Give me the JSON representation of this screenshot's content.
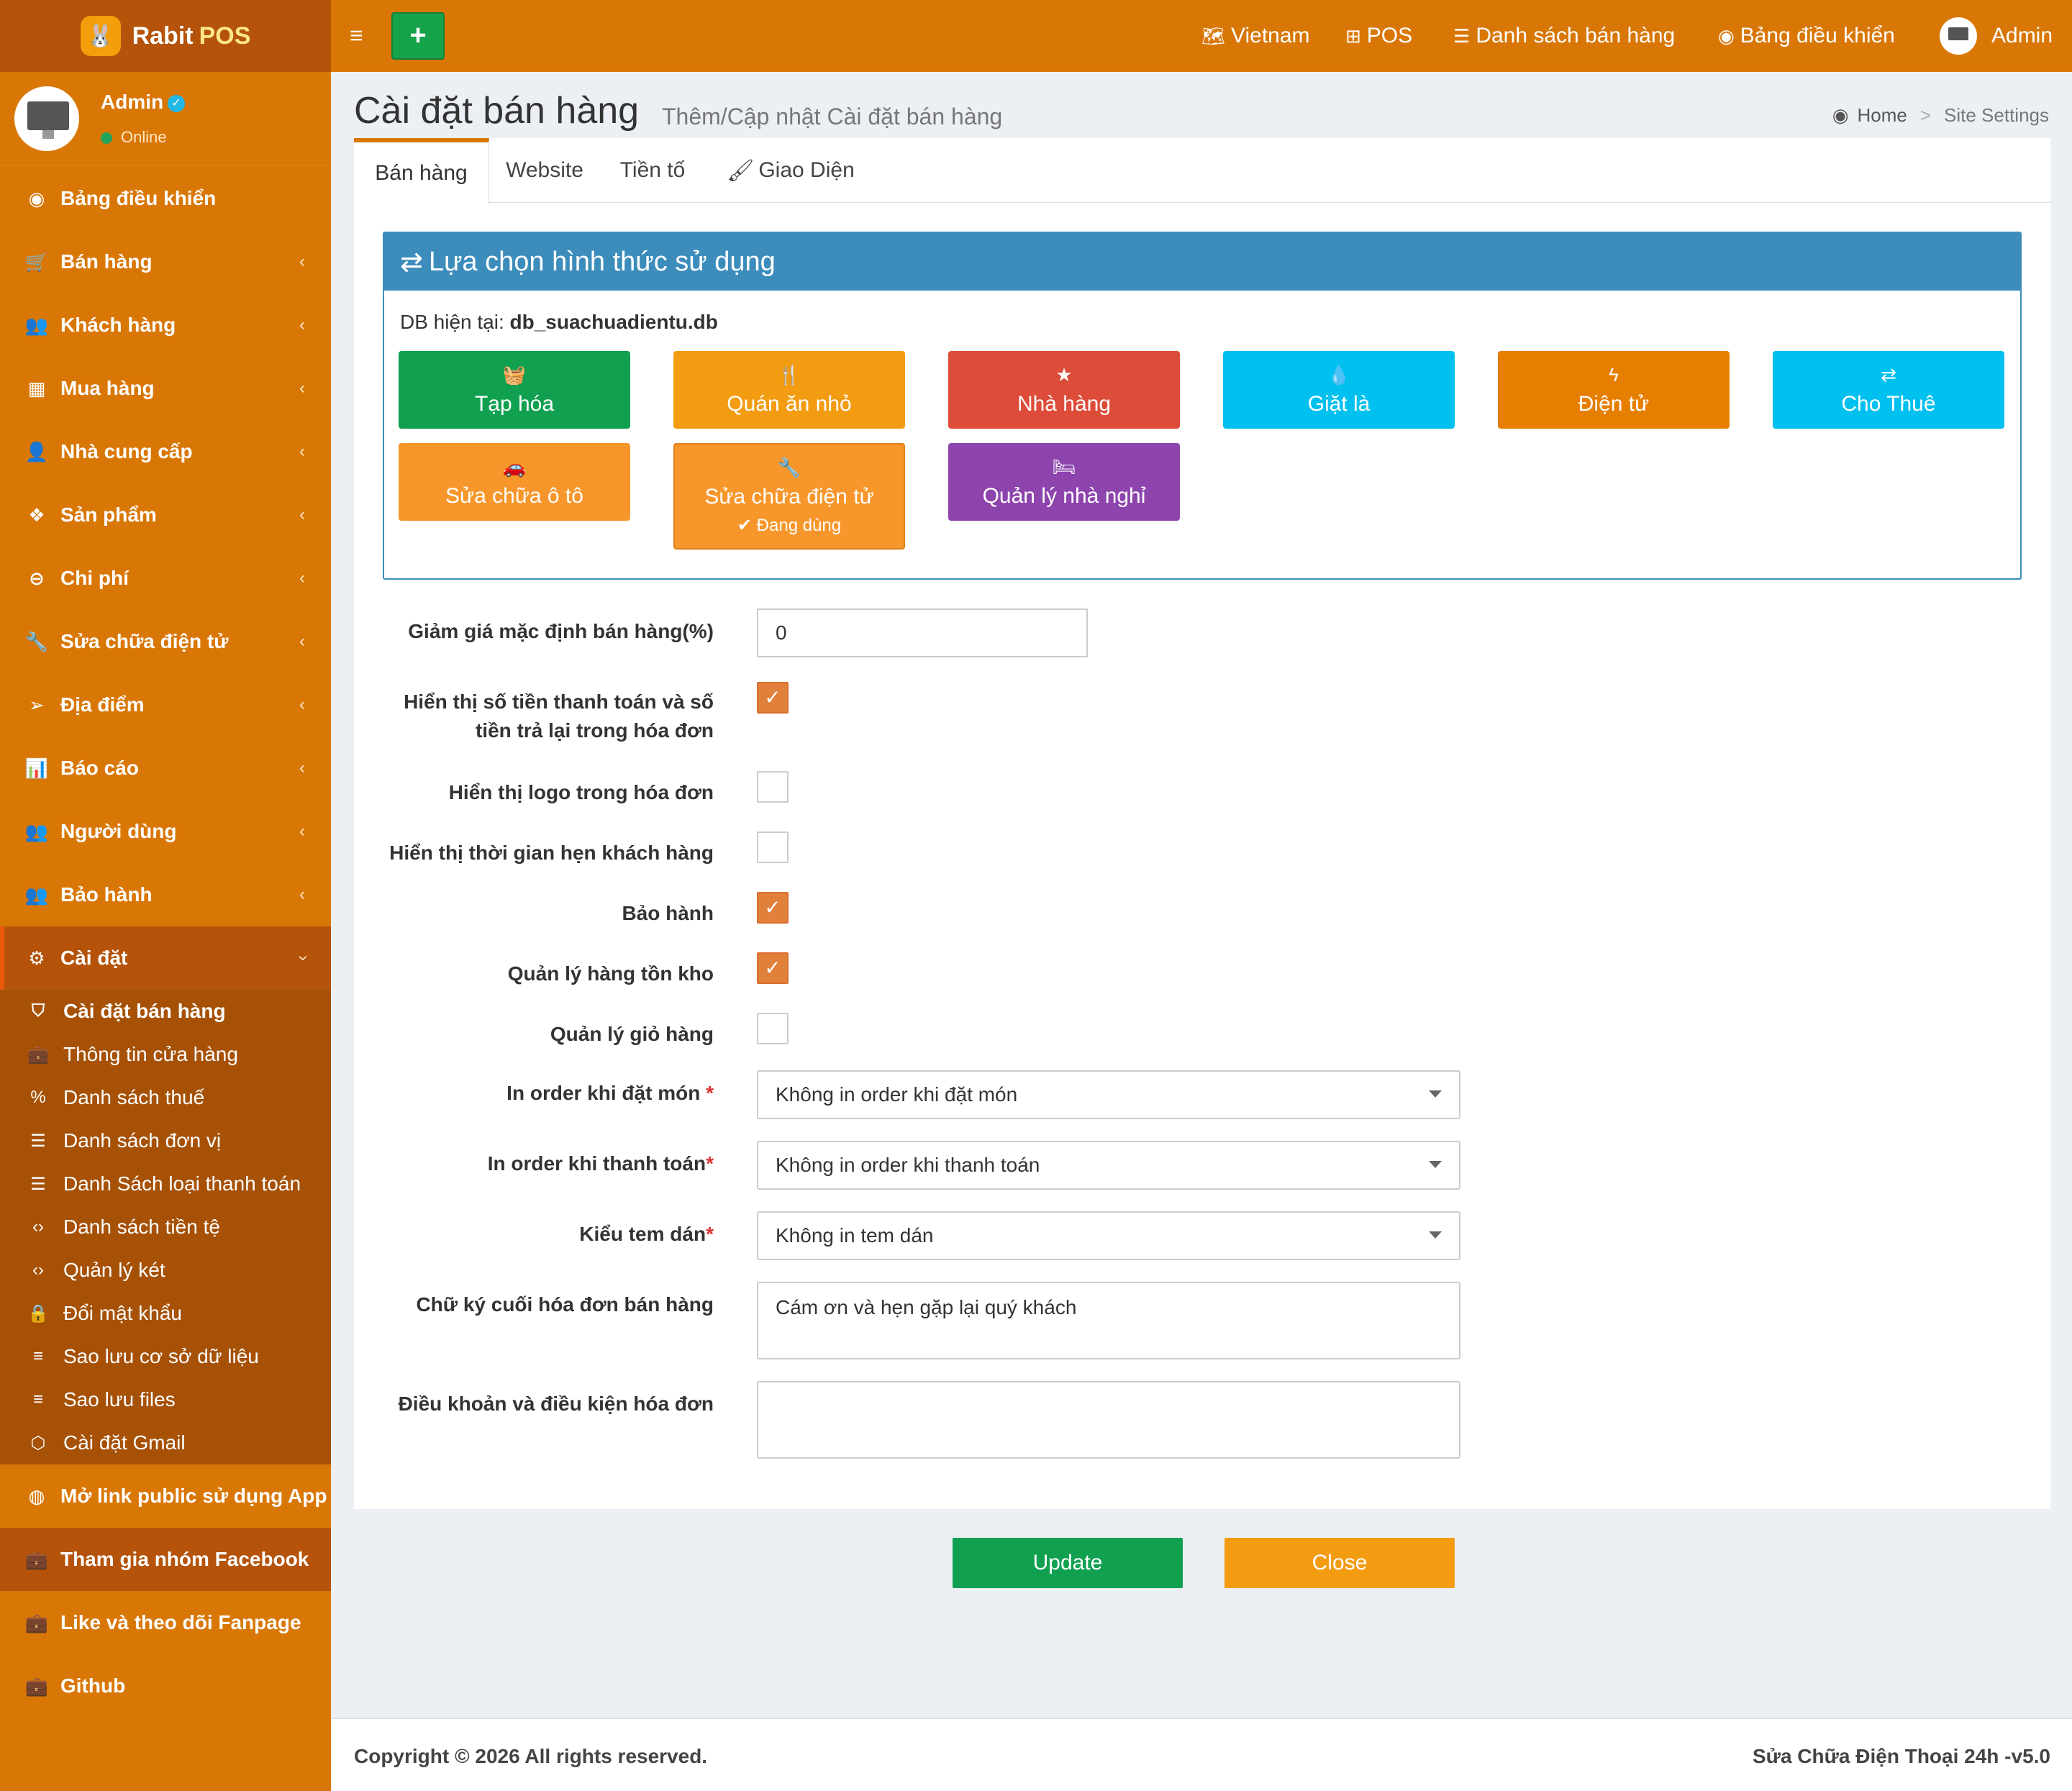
{
  "app": {
    "brand": "Rabit",
    "brand_suffix": "POS"
  },
  "user": {
    "name": "Admin",
    "status": "Online"
  },
  "sidebar": {
    "items": [
      {
        "label": "Bảng điều khiển",
        "icon": "dashboard-icon"
      },
      {
        "label": "Bán hàng",
        "icon": "cart-icon"
      },
      {
        "label": "Khách hàng",
        "icon": "users-icon"
      },
      {
        "label": "Mua hàng",
        "icon": "grid-icon"
      },
      {
        "label": "Nhà cung cấp",
        "icon": "user-plus-icon"
      },
      {
        "label": "Sản phẩm",
        "icon": "cubes-icon"
      },
      {
        "label": "Chi phí",
        "icon": "minus-circle-icon"
      },
      {
        "label": "Sửa chữa điện tử",
        "icon": "wrench-icon"
      },
      {
        "label": "Địa điểm",
        "icon": "paper-plane-icon"
      },
      {
        "label": "Báo cáo",
        "icon": "bar-chart-icon"
      },
      {
        "label": "Người dùng",
        "icon": "users-icon"
      },
      {
        "label": "Bảo hành",
        "icon": "users-icon"
      },
      {
        "label": "Cài đặt",
        "icon": "gears-icon"
      }
    ],
    "submenu": [
      {
        "label": "Cài đặt bán hàng",
        "icon": "shield-icon"
      },
      {
        "label": "Thông tin cửa hàng",
        "icon": "briefcase-icon"
      },
      {
        "label": "Danh sách thuế",
        "icon": "percent-icon"
      },
      {
        "label": "Danh sách đơn vị",
        "icon": "list-icon"
      },
      {
        "label": "Danh Sách loại thanh toán",
        "icon": "list-icon"
      },
      {
        "label": "Danh sách tiền tệ",
        "icon": "code-icon"
      },
      {
        "label": "Quản lý két",
        "icon": "code-icon"
      },
      {
        "label": "Đổi mật khẩu",
        "icon": "lock-icon"
      },
      {
        "label": "Sao lưu cơ sở dữ liệu",
        "icon": "database-icon"
      },
      {
        "label": "Sao lưu files",
        "icon": "database-icon"
      },
      {
        "label": "Cài đặt Gmail",
        "icon": "cube-icon"
      }
    ],
    "extra": [
      {
        "label": "Mở link public sử dụng App",
        "icon": "globe-icon"
      },
      {
        "label": "Tham gia nhóm Facebook",
        "icon": "briefcase-icon"
      },
      {
        "label": "Like và theo dõi Fanpage",
        "icon": "briefcase-icon"
      },
      {
        "label": "Github",
        "icon": "briefcase-icon"
      }
    ]
  },
  "topbar": {
    "language": "Vietnam",
    "pos": "POS",
    "sales_list": "Danh sách bán hàng",
    "dashboard": "Bảng điều khiển",
    "admin": "Admin"
  },
  "header": {
    "title": "Cài đặt bán hàng",
    "subtitle": "Thêm/Cập nhật Cài đặt bán hàng",
    "breadcrumb": [
      "Home",
      "Site Settings"
    ]
  },
  "tabs": [
    "Bán hàng",
    "Website",
    "Tiền tố",
    "Giao Diện"
  ],
  "choice": {
    "title": "Lựa chọn hình thức sử dụng",
    "db_label": "DB hiện tại:",
    "db_name": "db_suachuadientu.db",
    "modes": [
      {
        "label": "Tạp hóa",
        "icon": "basket-icon",
        "color": "#10a050"
      },
      {
        "label": "Quán ăn nhỏ",
        "icon": "cutlery-icon",
        "color": "#f39c12"
      },
      {
        "label": "Nhà hàng",
        "icon": "star-icon",
        "color": "#dd4b39"
      },
      {
        "label": "Giặt là",
        "icon": "drop-icon",
        "color": "#00c0ef"
      },
      {
        "label": "Điện tử",
        "icon": "bolt-icon",
        "color": "#e67e00"
      },
      {
        "label": "Cho Thuê",
        "icon": "exchange-icon",
        "color": "#00c0ef"
      },
      {
        "label": "Sửa chữa ô tô",
        "icon": "car-icon",
        "color": "#f7962a"
      },
      {
        "label": "Sửa chữa điện tử",
        "icon": "wrench-icon",
        "color": "#f7962a",
        "badge": "Đang dùng"
      },
      {
        "label": "Quản lý nhà nghỉ",
        "icon": "bed-icon",
        "color": "#8e44ad"
      }
    ]
  },
  "form": {
    "discount_label": "Giảm giá mặc định bán hàng(%)",
    "discount_value": "0",
    "show_paid_label_1": "Hiển thị số tiền thanh toán và số",
    "show_paid_label_2": "tiền trả lại trong hóa đơn",
    "show_paid": true,
    "show_logo_label": "Hiển thị logo trong hóa đơn",
    "show_logo": false,
    "show_appointment_label": "Hiển thị thời gian hẹn khách hàng",
    "show_appointment": false,
    "warranty_label": "Bảo hành",
    "warranty": true,
    "inventory_label": "Quản lý hàng tồn kho",
    "inventory": true,
    "cart_label": "Quản lý giỏ hàng",
    "cart": false,
    "print_order_label": "In order khi đặt món",
    "print_order_value": "Không in order khi đặt món",
    "print_pay_label": "In order khi thanh toán",
    "print_pay_value": "Không in order khi thanh toán",
    "sticker_label": "Kiểu tem dán",
    "sticker_value": "Không in tem dán",
    "signature_label": "Chữ ký cuối hóa đơn bán hàng",
    "signature_value": "Cám ơn và hẹn gặp lại quý khách",
    "terms_label": "Điều khoản và điều kiện hóa đơn",
    "terms_value": ""
  },
  "actions": {
    "update": "Update",
    "close": "Close",
    "update_color": "#10a050",
    "close_color": "#f39c12"
  },
  "footer": {
    "copyright": "Copyright © 2026 All rights reserved.",
    "version": "Sửa Chữa Điện Thoại 24h -v5.0"
  },
  "colors": {
    "sidebar": "#d97706",
    "sidebar_dark": "#b45309",
    "accent": "#3c8dbc"
  }
}
